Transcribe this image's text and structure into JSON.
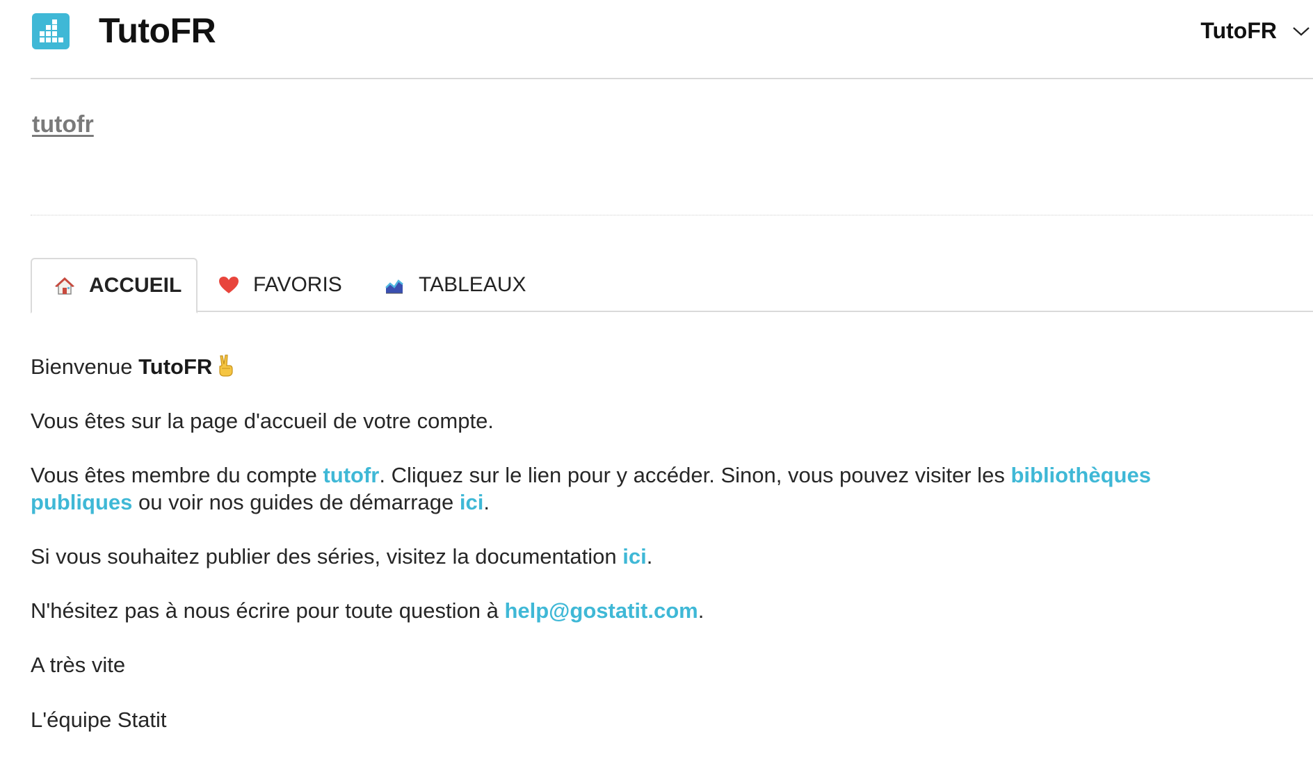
{
  "header": {
    "app_title": "TutoFR",
    "account_name": "TutoFR",
    "logo_icon": "bar-chart-logo-icon",
    "brand_color": "#3fb8d6"
  },
  "account": {
    "link_label": "tutofr"
  },
  "tabs": [
    {
      "label": "ACCUEIL",
      "icon": "house-icon",
      "active": true
    },
    {
      "label": "FAVORIS",
      "icon": "heart-icon",
      "active": false
    },
    {
      "label": "TABLEAUX",
      "icon": "chart-icon",
      "active": false
    }
  ],
  "welcome": {
    "greeting": "Bienvenue",
    "name": "TutoFR",
    "emoji": "victory-hand-icon",
    "line_home": "Vous êtes sur la page d'accueil de votre compte.",
    "member_prefix": "Vous êtes membre du compte",
    "member_account_link": "tutofr",
    "member_middle": ". Cliquez sur le lien pour y accéder. Sinon, vous pouvez visiter les",
    "public_libraries_link": "bibliothèques publiques",
    "member_after_libraries": "ou voir nos guides de démarrage",
    "guides_link": "ici",
    "period": ".",
    "publish_prefix": "Si vous souhaitez publier des séries, visitez la documentation",
    "docs_link": "ici",
    "contact_prefix": "N'hésitez pas à nous écrire pour toute question à",
    "contact_email": "help@gostatit.com",
    "closing": "A très vite",
    "signature": "L'équipe Statit"
  },
  "colors": {
    "link": "#3fb8d6",
    "heart": "#e8453c"
  }
}
